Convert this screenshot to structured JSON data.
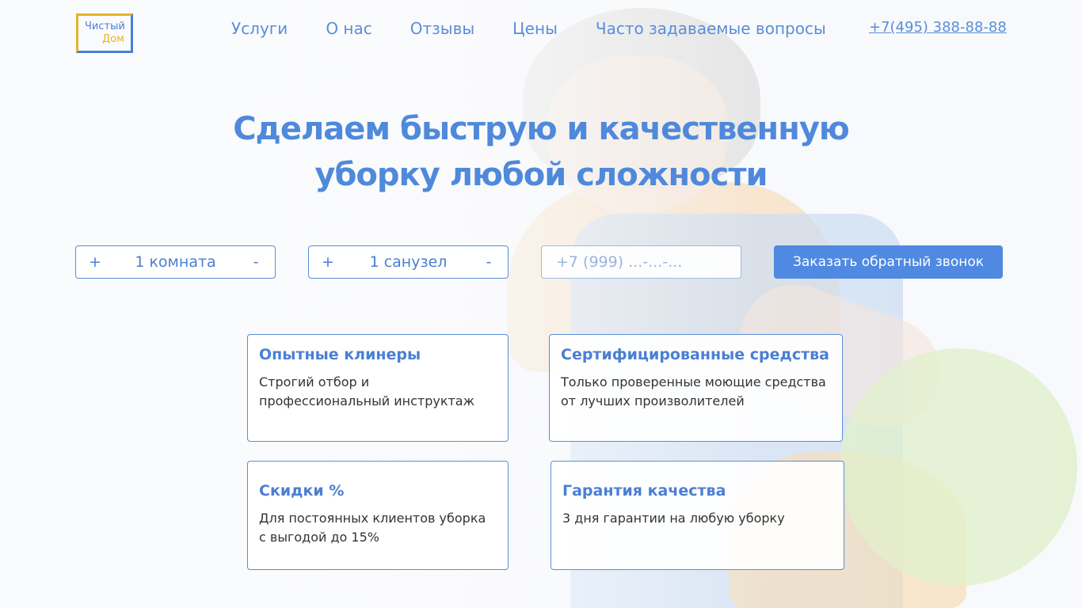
{
  "logo": {
    "line1": "Чистый",
    "line2": "Дом"
  },
  "nav": [
    {
      "label": "Услуги"
    },
    {
      "label": "О нас"
    },
    {
      "label": "Отзывы"
    },
    {
      "label": "Цены"
    },
    {
      "label": "Часто задаваемые вопросы"
    }
  ],
  "phone": "+7(495) 388-88-88",
  "hero": {
    "line1": "Сделаем быструю и качественную",
    "line2": "уборку любой сложности"
  },
  "form": {
    "rooms": {
      "plus": "+",
      "value": "1 комната",
      "minus": "-"
    },
    "bathrooms": {
      "plus": "+",
      "value": "1 санузел",
      "minus": "-"
    },
    "phone_placeholder": "+7 (999) ...-...-...",
    "submit_label": "Заказать обратный звонок"
  },
  "features": [
    {
      "title": "Опытные клинеры",
      "text": "Строгий отбор и профессиональный инструктаж"
    },
    {
      "title": "Сертифицированные средства",
      "text": "Только проверенные моющие средства от лучших произволителей"
    },
    {
      "title": "Скидки %",
      "text": "Для постоянных клиентов уборка с выгодой до 15%"
    },
    {
      "title": "Гарантия качества",
      "text": "3 дня гарантии на любую уборку"
    }
  ],
  "colors": {
    "accent": "#4f89e2",
    "logo_yellow": "#e5b22b",
    "text_blue": "#5a8ed8"
  }
}
